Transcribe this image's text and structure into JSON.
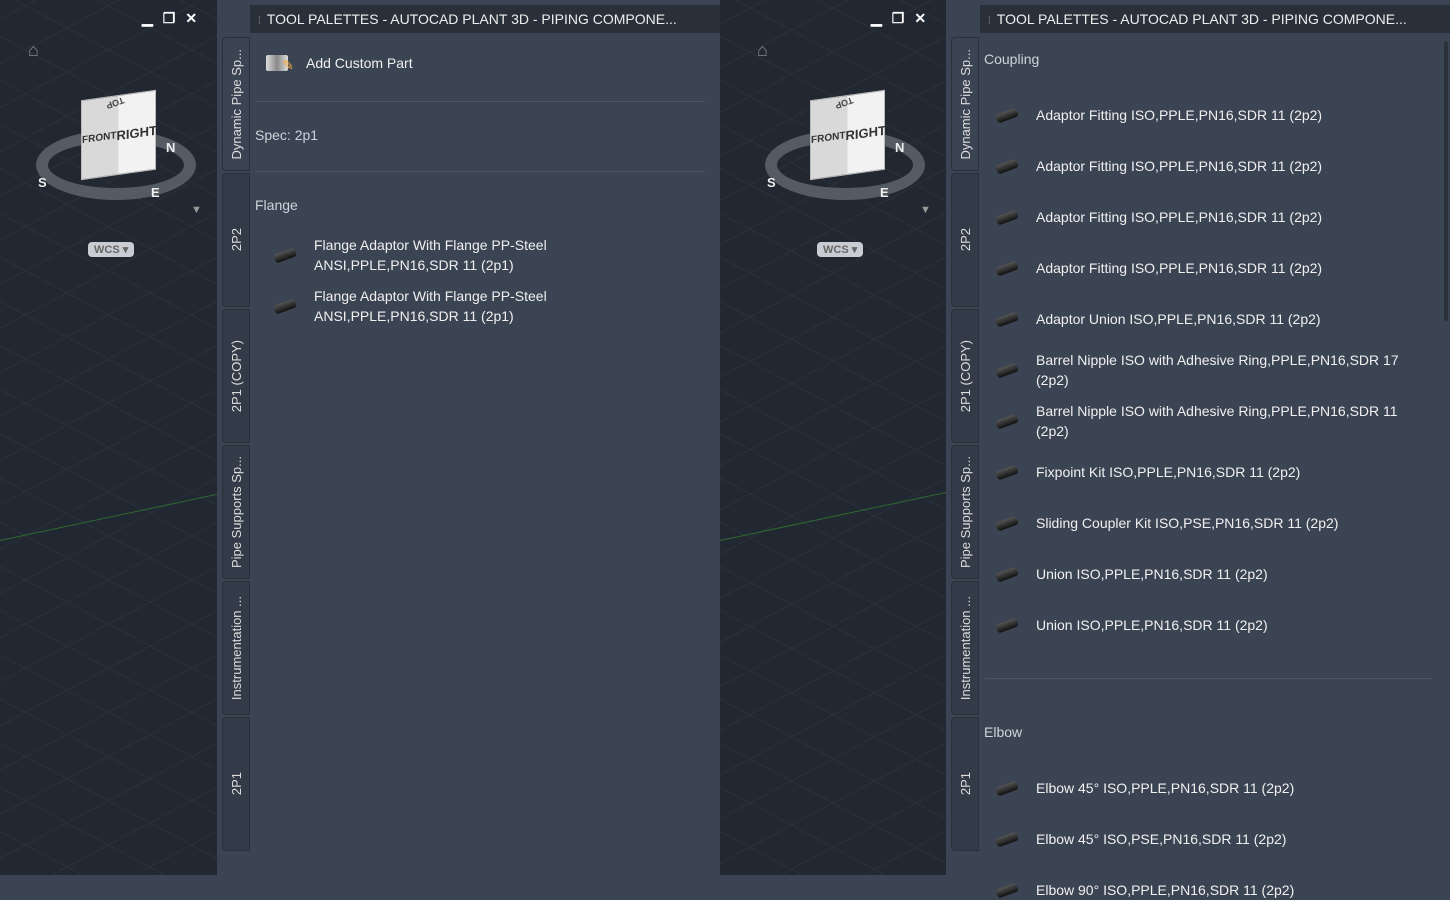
{
  "window_controls": {
    "minimize": "▁",
    "restore": "❐",
    "close": "✕"
  },
  "viewcube": {
    "top": "TOP",
    "front": "FRONT",
    "right": "RIGHT",
    "n": "N",
    "s": "S",
    "e": "E",
    "wcs": "WCS ▾"
  },
  "left_palette": {
    "title": "TOOL PALETTES - AUTOCAD PLANT 3D - PIPING COMPONE...",
    "tabs": [
      "Dynamic Pipe Sp...",
      "2P2",
      "2P1 (COPY)",
      "Pipe Supports Sp...",
      "Instrumentation ...",
      "2P1"
    ],
    "add_custom_part": "Add Custom Part",
    "spec": "Spec: 2p1",
    "section": "Flange",
    "items": [
      "Flange Adaptor With Flange PP-Steel\nANSI,PPLE,PN16,SDR 11 (2p1)",
      "Flange Adaptor With Flange PP-Steel\nANSI,PPLE,PN16,SDR 11 (2p1)"
    ]
  },
  "right_palette": {
    "title": "TOOL PALETTES - AUTOCAD PLANT 3D - PIPING COMPONE...",
    "tabs": [
      "Dynamic Pipe Sp...",
      "2P2",
      "2P1 (COPY)",
      "Pipe Supports Sp...",
      "Instrumentation ...",
      "2P1"
    ],
    "sections": [
      {
        "label": "Coupling",
        "items": [
          "Adaptor Fitting ISO,PPLE,PN16,SDR 11 (2p2)",
          "Adaptor Fitting ISO,PPLE,PN16,SDR 11 (2p2)",
          "Adaptor Fitting ISO,PPLE,PN16,SDR 11 (2p2)",
          "Adaptor Fitting ISO,PPLE,PN16,SDR 11 (2p2)",
          "Adaptor Union ISO,PPLE,PN16,SDR 11 (2p2)",
          "Barrel Nipple ISO with Adhesive Ring,PPLE,PN16,SDR 17\n(2p2)",
          "Barrel Nipple ISO with Adhesive Ring,PPLE,PN16,SDR 11\n(2p2)",
          "Fixpoint Kit ISO,PPLE,PN16,SDR 11 (2p2)",
          "Sliding Coupler Kit ISO,PSE,PN16,SDR 11 (2p2)",
          "Union ISO,PPLE,PN16,SDR 11 (2p2)",
          "Union ISO,PPLE,PN16,SDR 11 (2p2)"
        ]
      },
      {
        "label": "Elbow",
        "items": [
          "Elbow 45° ISO,PPLE,PN16,SDR 11 (2p2)",
          "Elbow 45° ISO,PSE,PN16,SDR 11 (2p2)",
          "Elbow 90° ISO,PPLE,PN16,SDR 11 (2p2)"
        ]
      }
    ]
  }
}
